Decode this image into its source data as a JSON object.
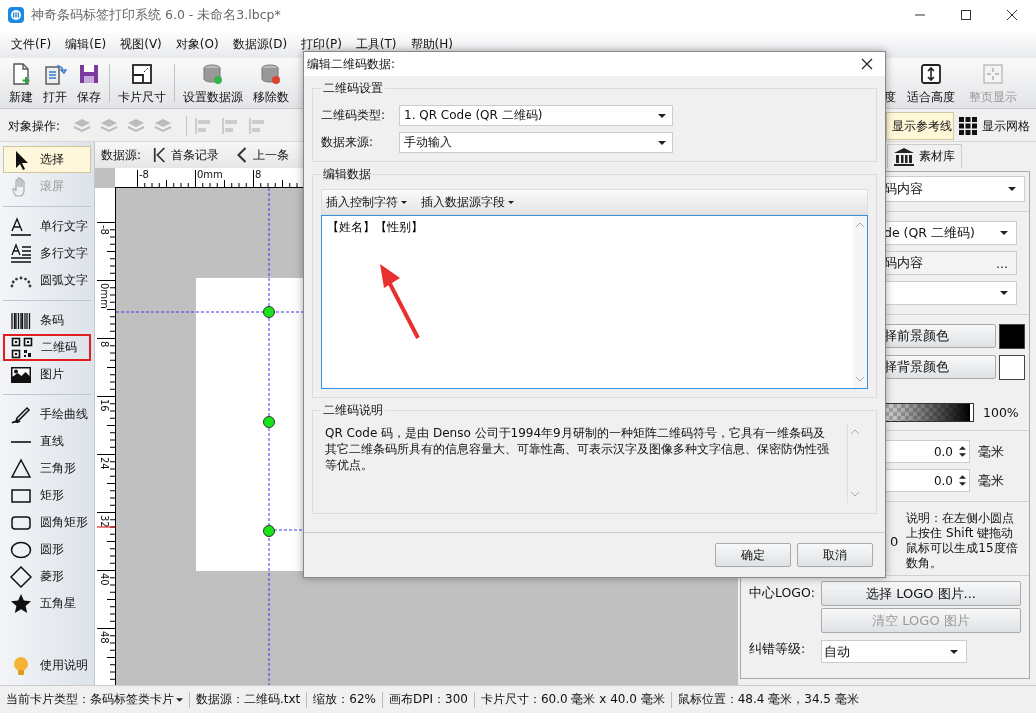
{
  "window": {
    "title": "神奇条码标签打印系统 6.0 - 未命名3.lbcp*"
  },
  "menu": [
    "文件(F)",
    "编辑(E)",
    "视图(V)",
    "对象(O)",
    "数据源(D)",
    "打印(P)",
    "工具(T)",
    "帮助(H)"
  ],
  "toolbar": {
    "groups": [
      [
        {
          "kind": "new",
          "label": "新建",
          "disabled": false
        },
        {
          "kind": "open",
          "label": "打开",
          "disabled": false
        },
        {
          "kind": "save",
          "label": "保存",
          "disabled": false
        }
      ],
      [
        {
          "kind": "card_size",
          "label": "卡片尺寸",
          "disabled": false
        }
      ],
      [
        {
          "kind": "db_setup",
          "label": "设置数据源",
          "disabled": false
        },
        {
          "kind": "db_remove",
          "label": "移除数",
          "disabled": false
        }
      ]
    ],
    "right": [
      {
        "kind": "fit_width",
        "label": "度",
        "disabled": false
      },
      {
        "kind": "fit_height",
        "label": "适合高度",
        "disabled": false
      },
      {
        "kind": "full_page",
        "label": "整页显示",
        "disabled": true
      }
    ]
  },
  "object_bar": {
    "label": "对象操作:",
    "toggles": [
      {
        "kind": "guides",
        "label": "显示参考线",
        "selected": true
      },
      {
        "kind": "grid",
        "label": "显示网格",
        "selected": false
      }
    ]
  },
  "tools": {
    "groups": [
      [
        {
          "kind": "select",
          "label": "选择",
          "selected": true,
          "disabled": false,
          "highlighted": false
        },
        {
          "kind": "pan",
          "label": "滚屏",
          "selected": false,
          "disabled": true,
          "highlighted": false
        }
      ],
      [
        {
          "kind": "text",
          "label": "单行文字",
          "selected": false,
          "disabled": false,
          "highlighted": false
        },
        {
          "kind": "multiline",
          "label": "多行文字",
          "selected": false,
          "disabled": false,
          "highlighted": false
        },
        {
          "kind": "arc",
          "label": "圆弧文字",
          "selected": false,
          "disabled": false,
          "highlighted": false
        }
      ],
      [
        {
          "kind": "barcode",
          "label": "条码",
          "selected": false,
          "disabled": false,
          "highlighted": false
        },
        {
          "kind": "qrcode",
          "label": "二维码",
          "selected": false,
          "disabled": false,
          "highlighted": true
        },
        {
          "kind": "image",
          "label": "图片",
          "selected": false,
          "disabled": false,
          "highlighted": false
        }
      ],
      [
        {
          "kind": "freehand",
          "label": "手绘曲线",
          "selected": false,
          "disabled": false,
          "highlighted": false
        },
        {
          "kind": "line",
          "label": "直线",
          "selected": false,
          "disabled": false,
          "highlighted": false
        },
        {
          "kind": "triangle",
          "label": "三角形",
          "selected": false,
          "disabled": false,
          "highlighted": false
        },
        {
          "kind": "rect",
          "label": "矩形",
          "selected": false,
          "disabled": false,
          "highlighted": false
        },
        {
          "kind": "roundrect",
          "label": "圆角矩形",
          "selected": false,
          "disabled": false,
          "highlighted": false
        },
        {
          "kind": "ellipse",
          "label": "圆形",
          "selected": false,
          "disabled": false,
          "highlighted": false
        },
        {
          "kind": "diamond",
          "label": "菱形",
          "selected": false,
          "disabled": false,
          "highlighted": false
        },
        {
          "kind": "star",
          "label": "五角星",
          "selected": false,
          "disabled": false,
          "highlighted": false
        }
      ]
    ],
    "help": "使用说明"
  },
  "datasource_bar": {
    "label": "数据源:",
    "buttons": [
      {
        "kind": "first",
        "label": "首条记录"
      },
      {
        "kind": "prev",
        "label": "上一条"
      }
    ]
  },
  "rulers": {
    "horizontal": [
      "-8",
      "0mm",
      "8"
    ],
    "vertical": [
      "-8",
      "0mm",
      "8",
      "16",
      "24",
      "32",
      "40",
      "48"
    ]
  },
  "dialog": {
    "title": "编辑二维码数据:",
    "settings": {
      "legend": "二维码设置",
      "type_label": "二维码类型:",
      "type_value": "1.  QR Code (QR 二维码)",
      "source_label": "数据来源:",
      "source_value": "手动输入"
    },
    "edit": {
      "legend": "编辑数据",
      "menus": [
        "插入控制字符",
        "插入数据源字段"
      ],
      "value": "【姓名】【性别】"
    },
    "info": {
      "legend": "二维码说明",
      "text": "QR Code 码，是由 Denso 公司于1994年9月研制的一种矩阵二维码符号，它具有一维条码及其它二维条码所具有的信息容量大、可靠性高、可表示汉字及图像多种文字信息、保密防伪性强等优点。"
    },
    "buttons": [
      "确定",
      "取消"
    ]
  },
  "right_panel": {
    "tab": "素材库",
    "content_select": "码内容",
    "type_select": "de (QR 二维码)",
    "content_field": "码内容",
    "content_more": "...",
    "fg_button": "择前景颜色",
    "bg_button": "择背景颜色",
    "opacity": {
      "level": 1,
      "reading": "100%"
    },
    "offsets": [
      {
        "value": "0.0",
        "unit": "毫米"
      },
      {
        "value": "0.0",
        "unit": "毫米"
      }
    ],
    "angle_value": "0",
    "note": "说明：在左侧小圆点上按住 Shift 键拖动鼠标可以生成15度倍数角。",
    "logo_label": "中心LOGO:",
    "logo_select": "选择 LOGO 图片...",
    "logo_clear": {
      "label": "清空  LOGO 图片",
      "disabled": true
    },
    "ecc_label": "纠错等级:",
    "ecc_value": "自动"
  },
  "status_bar": [
    {
      "kind": "dropdown",
      "text": "当前卡片类型：条码标签类卡片"
    },
    {
      "kind": "text",
      "text": "数据源：二维码.txt"
    },
    {
      "kind": "text",
      "text": "缩放：62%"
    },
    {
      "kind": "text",
      "text": "画布DPI：300"
    },
    {
      "kind": "text",
      "text": "卡片尺寸：60.0 毫米 x 40.0 毫米"
    },
    {
      "kind": "text",
      "text": "鼠标位置：48.4 毫米，34.5 毫米"
    }
  ]
}
